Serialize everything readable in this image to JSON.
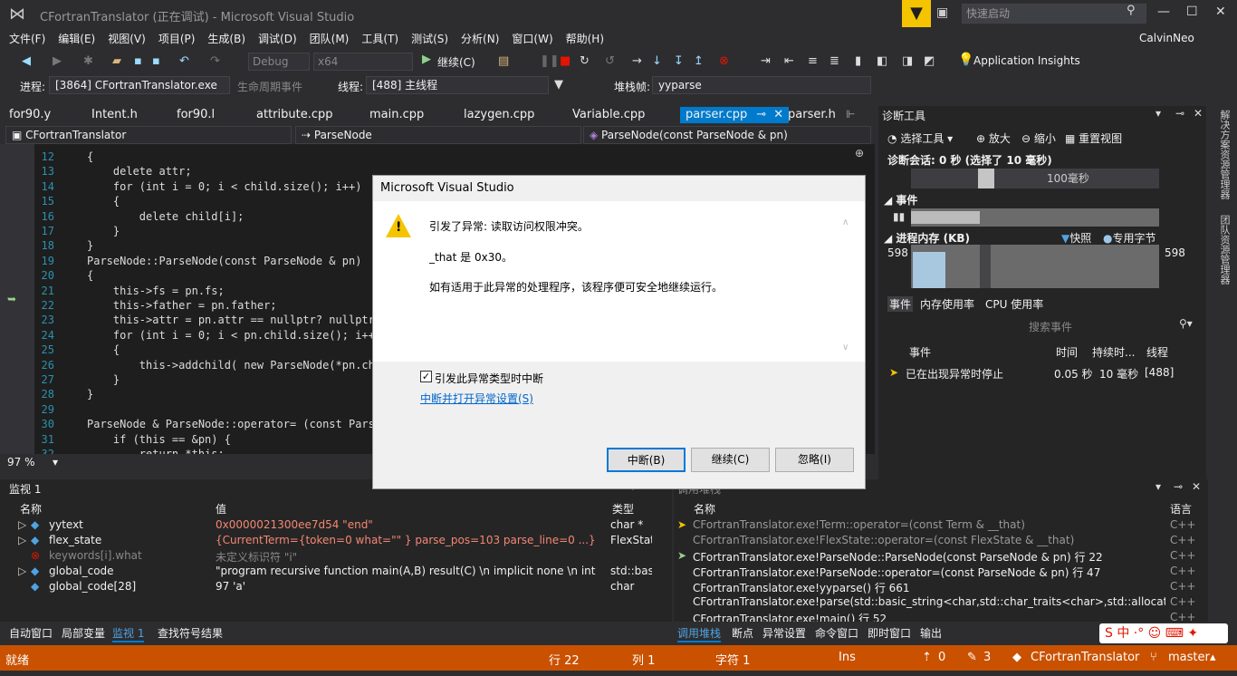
{
  "window": {
    "title": "CFortranTranslator (正在调试) - Microsoft Visual Studio",
    "quick_launch": "快速启动"
  },
  "menu": [
    "文件(F)",
    "编辑(E)",
    "视图(V)",
    "项目(P)",
    "生成(B)",
    "调试(D)",
    "团队(M)",
    "工具(T)",
    "测试(S)",
    "分析(N)",
    "窗口(W)",
    "帮助(H)"
  ],
  "user": "CalvinNeo",
  "toolbar": {
    "config": "Debug",
    "platform": "x64",
    "continue": "继续(C)",
    "app_insights": "Application Insights"
  },
  "debugbar": {
    "process_label": "进程:",
    "process": "[3864] CFortranTranslator.exe",
    "lifecycle": "生命周期事件",
    "thread_label": "线程:",
    "thread": "[488] 主线程",
    "stack_label": "堆栈帧:",
    "stack": "yyparse"
  },
  "tabs": [
    "for90.y",
    "Intent.h",
    "for90.l",
    "attribute.cpp",
    "main.cpp",
    "lazygen.cpp",
    "Variable.cpp",
    "parser.cpp",
    "parser.h"
  ],
  "navbar": {
    "scope": "CFortranTranslator",
    "type": "ParseNode",
    "member": "ParseNode(const ParseNode & pn)"
  },
  "code": [
    {
      "n": "12",
      "t": "{"
    },
    {
      "n": "13",
      "t": "    delete attr;"
    },
    {
      "n": "14",
      "t": "    for (int i = 0; i < child.size(); i++)"
    },
    {
      "n": "15",
      "t": "    {"
    },
    {
      "n": "16",
      "t": "        delete child[i];"
    },
    {
      "n": "17",
      "t": "    }"
    },
    {
      "n": "18",
      "t": "}"
    },
    {
      "n": "19",
      "t": "ParseNode::ParseNode(const ParseNode & pn)"
    },
    {
      "n": "20",
      "t": "{"
    },
    {
      "n": "21",
      "t": "    this->fs = pn.fs;"
    },
    {
      "n": "22",
      "t": "    this->father = pn.father;"
    },
    {
      "n": "23",
      "t": "    this->attr = pn.attr == nullptr? nullptr:"
    },
    {
      "n": "24",
      "t": "    for (int i = 0; i < pn.child.size(); i++)"
    },
    {
      "n": "25",
      "t": "    {"
    },
    {
      "n": "26",
      "t": "        this->addchild( new ParseNode(*pn.chil"
    },
    {
      "n": "27",
      "t": "    }"
    },
    {
      "n": "28",
      "t": "}"
    },
    {
      "n": "29",
      "t": ""
    },
    {
      "n": "30",
      "t": "ParseNode & ParseNode::operator= (const ParseN"
    },
    {
      "n": "31",
      "t": "    if (this == &pn) {"
    },
    {
      "n": "32",
      "t": "        return *this;"
    }
  ],
  "zoom": "97 %",
  "diagnostics": {
    "title": "诊断工具",
    "select_tool": "选择工具",
    "zoom_in": "放大",
    "zoom_out": "缩小",
    "reset_view": "重置视图",
    "session": "诊断会话: 0 秒 (选择了 10 毫秒)",
    "timeline_label": "100毫秒",
    "events_label": "事件",
    "memory_label": "进程内存 (KB)",
    "snapshot": "快照",
    "private_bytes": "专用字节",
    "mem_left": "598",
    "mem_right": "598",
    "tabs": [
      "事件",
      "内存使用率",
      "CPU 使用率"
    ],
    "search": "搜索事件",
    "columns": [
      "事件",
      "时间",
      "持续时...",
      "线程"
    ],
    "row": {
      "event": "已在出现异常时停止",
      "time": "0.05 秒",
      "duration": "10 毫秒",
      "thread": "[488]"
    }
  },
  "watch": {
    "title": "监视 1",
    "columns": [
      "名称",
      "值",
      "类型"
    ],
    "rows": [
      {
        "name": "yytext",
        "value": "0x0000021300ee7d54 \"end\"",
        "type": "char *"
      },
      {
        "name": "flex_state",
        "value": "{CurrentTerm={token=0 what=\"\" } parse_pos=103 parse_line=0 ...}",
        "type": "FlexState"
      },
      {
        "name": "keywords[i].what",
        "value": "未定义标识符 \"i\"",
        "type": ""
      },
      {
        "name": "global_code",
        "value": "\"program recursive function main(A,B) result(C) \\n implicit none \\n integer::a",
        "type": "std::basic"
      },
      {
        "name": "global_code[28]",
        "value": "97 'a'",
        "type": "char"
      }
    ]
  },
  "callstack": {
    "title": "调用堆栈",
    "columns": [
      "名称",
      "语言"
    ],
    "rows": [
      {
        "name": "CFortranTranslator.exe!Term::operator=(const Term & __that)",
        "lang": "C++"
      },
      {
        "name": "CFortranTranslator.exe!FlexState::operator=(const FlexState & __that)",
        "lang": "C++"
      },
      {
        "name": "CFortranTranslator.exe!ParseNode::ParseNode(const ParseNode & pn) 行 22",
        "lang": "C++"
      },
      {
        "name": "CFortranTranslator.exe!ParseNode::operator=(const ParseNode & pn) 行 47",
        "lang": "C++"
      },
      {
        "name": "CFortranTranslator.exe!yyparse() 行 661",
        "lang": "C++"
      },
      {
        "name": "CFortranTranslator.exe!parse(std::basic_string<char,std::char_traits<char>,std::allocator<char> > co",
        "lang": "C++"
      },
      {
        "name": "CFortranTranslator.exe!main() 行 52",
        "lang": "C++"
      }
    ]
  },
  "bottom_tabs_left": [
    "自动窗口",
    "局部变量",
    "监视 1",
    "查找符号结果"
  ],
  "bottom_tabs_right": [
    "调用堆栈",
    "断点",
    "异常设置",
    "命令窗口",
    "即时窗口",
    "输出"
  ],
  "status": {
    "ready": "就绪",
    "line": "行 22",
    "col": "列 1",
    "char": "字符 1",
    "ins": "Ins",
    "up": "0",
    "pencil": "3",
    "repo": "CFortranTranslator",
    "branch": "master"
  },
  "dialog": {
    "title": "Microsoft Visual Studio",
    "message1": "引发了异常: 读取访问权限冲突。",
    "message2": "_that 是 0x30。",
    "message3": "如有适用于此异常的处理程序，该程序便可安全地继续运行。",
    "checkbox": "引发此异常类型时中断",
    "link": "中断并打开异常设置(S)",
    "buttons": [
      "中断(B)",
      "继续(C)",
      "忽略(I)"
    ]
  },
  "side_tabs": [
    "解决方案资源管理器",
    "团队资源管理器"
  ],
  "colors": {
    "status_bar": "#ca5100",
    "accent": "#007acc",
    "filter": "#f5c400"
  }
}
